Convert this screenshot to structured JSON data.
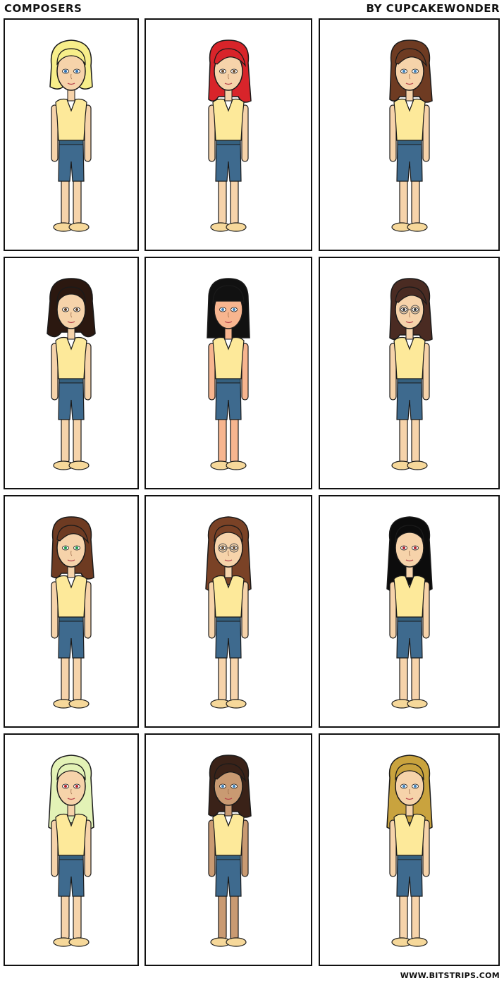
{
  "comic": {
    "title": "COMPOSERS",
    "byline": "BY CUPCAKEWONDER",
    "footer": "WWW.BITSTRIPS.COM"
  },
  "characters": [
    {
      "hair": "#f7ee8a",
      "hair_style": "short-wavy",
      "skin": "#f6d3aa",
      "eyes": "#2e6fb0",
      "glasses": false
    },
    {
      "hair": "#d8242a",
      "hair_style": "side-swept",
      "skin": "#f6d3aa",
      "eyes": "#6b4a2a",
      "glasses": false
    },
    {
      "hair": "#6e3b22",
      "hair_style": "side-swept",
      "skin": "#f6d3aa",
      "eyes": "#3d7fb8",
      "glasses": false
    },
    {
      "hair": "#2b1810",
      "hair_style": "wavy",
      "skin": "#f6d3aa",
      "eyes": "#5a3b22",
      "glasses": false
    },
    {
      "hair": "#111111",
      "hair_style": "bangs",
      "skin": "#f7b58f",
      "eyes": "#3d7fb8",
      "glasses": false
    },
    {
      "hair": "#4a2b22",
      "hair_style": "side-swept",
      "skin": "#f6d3aa",
      "eyes": "#333333",
      "glasses": true
    },
    {
      "hair": "#6e3b22",
      "hair_style": "side-swept",
      "skin": "#f6d3aa",
      "eyes": "#1f9a4a",
      "glasses": false
    },
    {
      "hair": "#7a4226",
      "hair_style": "long",
      "skin": "#f6d3aa",
      "eyes": "#6b4a2a",
      "glasses": true
    },
    {
      "hair": "#0c0c0c",
      "hair_style": "long",
      "skin": "#f6d3aa",
      "eyes": "#b5222a",
      "glasses": false
    },
    {
      "hair": "#e3f2b6",
      "hair_style": "long",
      "skin": "#f6d3aa",
      "eyes": "#b5222a",
      "glasses": false
    },
    {
      "hair": "#3a2218",
      "hair_style": "side-swept",
      "skin": "#c99a72",
      "eyes": "#3d7fb8",
      "glasses": false
    },
    {
      "hair": "#c9a33e",
      "hair_style": "long",
      "skin": "#f6d3aa",
      "eyes": "#3d7fb8",
      "glasses": false
    }
  ]
}
